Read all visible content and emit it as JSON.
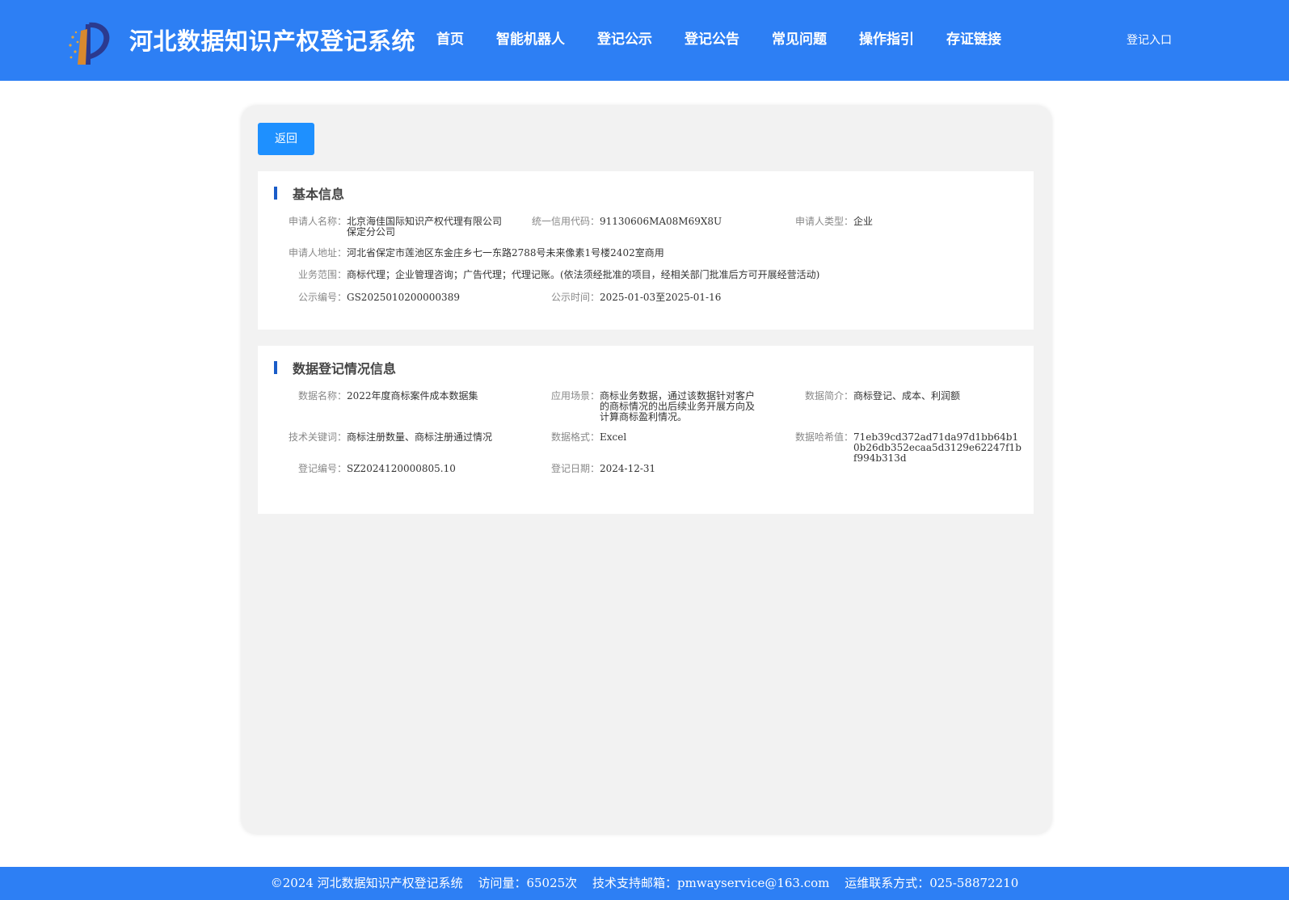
{
  "header": {
    "site_title": "河北数据知识产权登记系统",
    "nav": [
      "首页",
      "智能机器人",
      "登记公示",
      "登记公告",
      "常见问题",
      "操作指引",
      "存证链接"
    ],
    "login_label": "登记入口",
    "logo_icon": "p-logo-icon",
    "background_color": "#2d7ff4"
  },
  "actions": {
    "back_label": "返回",
    "back_color": "#1e90ff"
  },
  "basic": {
    "title": "基本信息",
    "applicant_name_label": "申请人名称：",
    "applicant_name": "北京海佳国际知识产权代理有限公司保定分公司",
    "credit_code_label": "统一信用代码：",
    "credit_code": "91130606MA08M69X8U",
    "applicant_type_label": "申请人类型：",
    "applicant_type": "企业",
    "address_label": "申请人地址：",
    "address": "河北省保定市莲池区东金庄乡七一东路2788号未来像素1号楼2402室商用",
    "scope_label": "业务范围：",
    "scope": "商标代理；企业管理咨询；广告代理；代理记账。(依法须经批准的项目，经相关部门批准后方可开展经营活动)",
    "notice_no_label": "公示编号：",
    "notice_no": "GS2025010200000389",
    "notice_time_label": "公示时间：",
    "notice_time": "2025-01-03至2025-01-16"
  },
  "data_reg": {
    "title": "数据登记情况信息",
    "data_name_label": "数据名称：",
    "data_name": "2022年度商标案件成本数据集",
    "scenario_label": "应用场景：",
    "scenario": "商标业务数据，通过该数据针对客户的商标情况的出后续业务开展方向及计算商标盈利情况。",
    "summary_label": "数据简介：",
    "summary": "商标登记、成本、利润额",
    "keywords_label": "技术关键词：",
    "keywords": "商标注册数量、商标注册通过情况",
    "format_label": "数据格式：",
    "format": "Excel",
    "hash_label": "数据哈希值：",
    "hash": "71eb39cd372ad71da97d1bb64b10b26db352ecaa5d3129e62247f1bf994b313d",
    "reg_no_label": "登记编号：",
    "reg_no": "SZ2024120000805.10",
    "reg_date_label": "登记日期：",
    "reg_date": "2024-12-31"
  },
  "footer": {
    "copyright": "©2024 河北数据知识产权登记系统",
    "visits": "访问量：65025次",
    "email": "技术支持邮箱：pmwayservice@163.com",
    "contact": "运维联系方式：025-58872210"
  }
}
